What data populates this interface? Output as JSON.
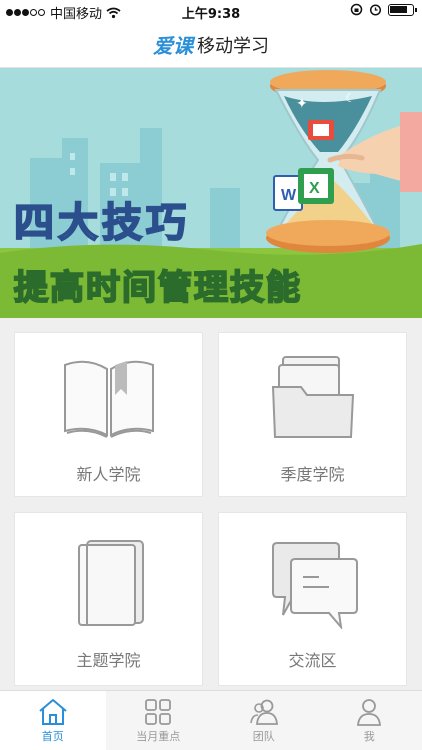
{
  "status_bar": {
    "carrier": "中国移动",
    "time": "上午9:38"
  },
  "header": {
    "brand": "爱课",
    "title": "移动学习"
  },
  "banner": {
    "line1": "四大技巧",
    "line2": "提高时间管理技能"
  },
  "cards": [
    {
      "label": "新人学院",
      "icon": "open-book-icon"
    },
    {
      "label": "季度学院",
      "icon": "folder-icon"
    },
    {
      "label": "主题学院",
      "icon": "closed-book-icon"
    },
    {
      "label": "交流区",
      "icon": "chat-bubbles-icon"
    }
  ],
  "tabs": [
    {
      "label": "首页",
      "icon": "home-icon",
      "active": true
    },
    {
      "label": "当月重点",
      "icon": "grid-icon"
    },
    {
      "label": "团队",
      "icon": "team-icon"
    },
    {
      "label": "我",
      "icon": "person-icon"
    }
  ],
  "colors": {
    "accent": "#2a8fd8",
    "banner_bg": "#a7dcdc",
    "grass": "#8cc63f"
  }
}
